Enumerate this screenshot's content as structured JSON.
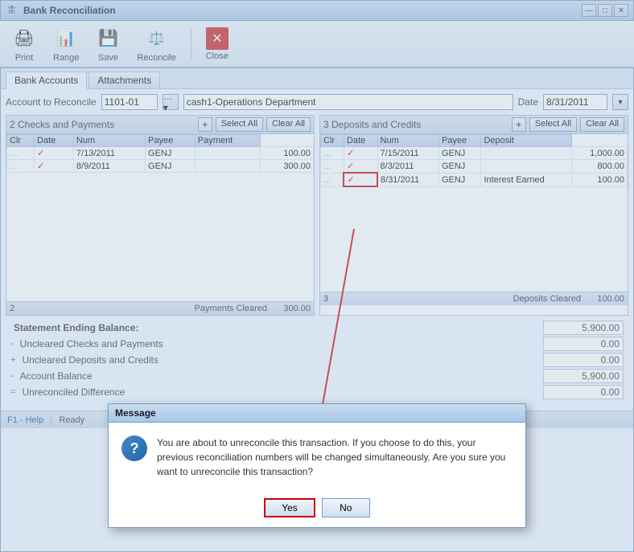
{
  "window": {
    "title": "Bank Reconciliation",
    "icon": "🏦"
  },
  "titlebar": {
    "minimize": "—",
    "maximize": "□",
    "close": "✕"
  },
  "toolbar": {
    "items": [
      {
        "name": "print",
        "label": "Print",
        "icon": "🖨"
      },
      {
        "name": "range",
        "label": "Range",
        "icon": "📊"
      },
      {
        "name": "save",
        "label": "Save",
        "icon": "💾"
      },
      {
        "name": "reconcile",
        "label": "Reconcile",
        "icon": "⚖"
      },
      {
        "name": "close",
        "label": "Close",
        "icon": "❌"
      }
    ]
  },
  "tabs": [
    {
      "label": "Bank Accounts",
      "active": true
    },
    {
      "label": "Attachments",
      "active": false
    }
  ],
  "account": {
    "label": "Account to Reconcile",
    "number": "1101-01",
    "name": "cash1-Operations Department",
    "date_label": "Date",
    "date": "8/31/2011"
  },
  "checks_panel": {
    "title": "2  Checks and Payments",
    "count": 2,
    "select_all": "Select All",
    "clear_all": "Clear All",
    "columns": [
      "Clr",
      "Date",
      "Num",
      "Payee",
      "Payment"
    ],
    "rows": [
      {
        "handle": "…",
        "clr": true,
        "date": "7/13/2011",
        "num": "GENJ",
        "payee": "",
        "payment": "100.00"
      },
      {
        "handle": "…",
        "clr": true,
        "date": "8/9/2011",
        "num": "GENJ",
        "payee": "",
        "payment": "300.00"
      }
    ],
    "footer_label": "Payments Cleared",
    "footer_amount": "300.00"
  },
  "deposits_panel": {
    "title": "3  Deposits and Credits",
    "count": 3,
    "select_all": "Select All",
    "clear_all": "Clear All",
    "columns": [
      "Clr",
      "Date",
      "Num",
      "Payee",
      "Deposit"
    ],
    "rows": [
      {
        "handle": "…",
        "clr": true,
        "date": "7/15/2011",
        "num": "GENJ",
        "payee": "",
        "deposit": "1,000.00"
      },
      {
        "handle": "…",
        "clr": true,
        "date": "8/3/2011",
        "num": "GENJ",
        "payee": "",
        "deposit": "800.00"
      },
      {
        "handle": "…",
        "clr": true,
        "date": "8/31/2011",
        "num": "GENJ",
        "payee": "Interest Earned",
        "deposit": "100.00",
        "highlighted": true
      }
    ],
    "footer_label": "Deposits Cleared",
    "footer_amount": "100.00"
  },
  "summary": {
    "statement_ending_balance": {
      "label": "Statement Ending Balance:",
      "value": "5,900.00"
    },
    "uncleared_checks": {
      "symbol": "-",
      "label": "Uncleared Checks and Payments",
      "value": "0.00"
    },
    "uncleared_deposits": {
      "symbol": "+",
      "label": "Uncleared Deposits and Credits",
      "value": "0.00"
    },
    "account_balance": {
      "symbol": "-",
      "label": "Account Balance",
      "value": "5,900.00"
    },
    "unreconciled": {
      "symbol": "=",
      "label": "Unreconciled Difference",
      "value": "0.00"
    }
  },
  "statusbar": {
    "help": "F1 - Help",
    "status": "Ready"
  },
  "dialog": {
    "title": "Message",
    "message": "You are about to unreconcile this transaction. If you choose to do this, your previous reconciliation numbers will be changed simultaneously. Are you sure you want to unreconcile this transaction?",
    "yes_label": "Yes",
    "no_label": "No"
  }
}
